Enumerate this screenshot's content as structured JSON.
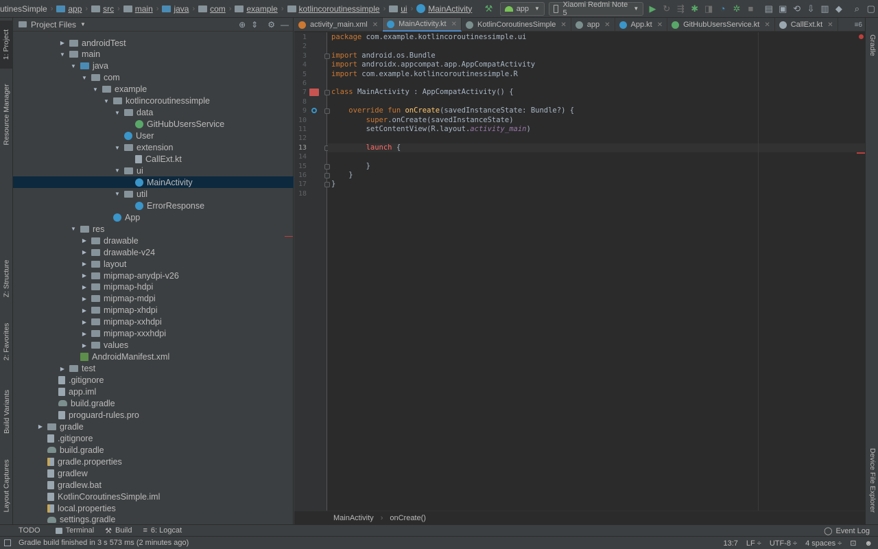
{
  "navbar": {
    "breadcrumbs": [
      "utinesSimple",
      "app",
      "src",
      "main",
      "java",
      "com",
      "example",
      "kotlincoroutinessimple",
      "ui",
      "MainActivity"
    ],
    "run_config": "app",
    "device": "Xiaomi Redmi Note 5"
  },
  "left_tool_tabs": [
    "1: Project",
    "Resource Manager",
    "Z: Structure",
    "2: Favorites",
    "Build Variants",
    "Layout Captures"
  ],
  "right_tool_tabs": [
    "Gradle",
    "Device File Explorer"
  ],
  "project_panel": {
    "title": "Project Files",
    "tree": [
      {
        "label": "androidTest",
        "arrow": "▶",
        "icon": "folder"
      },
      {
        "label": "main",
        "arrow": "▼",
        "icon": "folder"
      },
      {
        "label": "java",
        "arrow": "▼",
        "icon": "folder-blue"
      },
      {
        "label": "com",
        "arrow": "▼",
        "icon": "folder"
      },
      {
        "label": "example",
        "arrow": "▼",
        "icon": "folder"
      },
      {
        "label": "kotlincoroutinessimple",
        "arrow": "▼",
        "icon": "folder"
      },
      {
        "label": "data",
        "arrow": "▼",
        "icon": "folder"
      },
      {
        "label": "GitHubUsersService",
        "arrow": "",
        "icon": "kinterface"
      },
      {
        "label": "User",
        "arrow": "",
        "icon": "kclass"
      },
      {
        "label": "extension",
        "arrow": "▼",
        "icon": "folder"
      },
      {
        "label": "CallExt.kt",
        "arrow": "",
        "icon": "file"
      },
      {
        "label": "ui",
        "arrow": "▼",
        "icon": "folder"
      },
      {
        "label": "MainActivity",
        "arrow": "",
        "icon": "kclass"
      },
      {
        "label": "util",
        "arrow": "▼",
        "icon": "folder"
      },
      {
        "label": "ErrorResponse",
        "arrow": "",
        "icon": "kclass"
      },
      {
        "label": "App",
        "arrow": "",
        "icon": "kclass"
      },
      {
        "label": "res",
        "arrow": "▼",
        "icon": "folder"
      },
      {
        "label": "drawable",
        "arrow": "▶",
        "icon": "folder"
      },
      {
        "label": "drawable-v24",
        "arrow": "▶",
        "icon": "folder"
      },
      {
        "label": "layout",
        "arrow": "▶",
        "icon": "folder"
      },
      {
        "label": "mipmap-anydpi-v26",
        "arrow": "▶",
        "icon": "folder"
      },
      {
        "label": "mipmap-hdpi",
        "arrow": "▶",
        "icon": "folder"
      },
      {
        "label": "mipmap-mdpi",
        "arrow": "▶",
        "icon": "folder"
      },
      {
        "label": "mipmap-xhdpi",
        "arrow": "▶",
        "icon": "folder"
      },
      {
        "label": "mipmap-xxhdpi",
        "arrow": "▶",
        "icon": "folder"
      },
      {
        "label": "mipmap-xxxhdpi",
        "arrow": "▶",
        "icon": "folder"
      },
      {
        "label": "values",
        "arrow": "▶",
        "icon": "folder"
      },
      {
        "label": "AndroidManifest.xml",
        "arrow": "",
        "icon": "xml"
      },
      {
        "label": "test",
        "arrow": "▶",
        "icon": "folder"
      },
      {
        "label": ".gitignore",
        "arrow": "",
        "icon": "file"
      },
      {
        "label": "app.iml",
        "arrow": "",
        "icon": "file"
      },
      {
        "label": "build.gradle",
        "arrow": "",
        "icon": "gradle"
      },
      {
        "label": "proguard-rules.pro",
        "arrow": "",
        "icon": "file"
      },
      {
        "label": "gradle",
        "arrow": "▶",
        "icon": "folder"
      },
      {
        "label": ".gitignore",
        "arrow": "",
        "icon": "file"
      },
      {
        "label": "build.gradle",
        "arrow": "",
        "icon": "gradle"
      },
      {
        "label": "gradle.properties",
        "arrow": "",
        "icon": "props"
      },
      {
        "label": "gradlew",
        "arrow": "",
        "icon": "file"
      },
      {
        "label": "gradlew.bat",
        "arrow": "",
        "icon": "file"
      },
      {
        "label": "KotlinCoroutinesSimple.iml",
        "arrow": "",
        "icon": "file"
      },
      {
        "label": "local.properties",
        "arrow": "",
        "icon": "props"
      },
      {
        "label": "settings.gradle",
        "arrow": "",
        "icon": "gradle"
      }
    ],
    "selected": "MainActivity"
  },
  "editor": {
    "tabs": [
      {
        "label": "activity_main.xml",
        "icon_color": "#cc7832",
        "active": false
      },
      {
        "label": "MainActivity.kt",
        "icon_color": "#3a95c9",
        "active": true
      },
      {
        "label": "KotlinCoroutinesSimple",
        "icon_color": "#7c8f8f",
        "active": false
      },
      {
        "label": "app",
        "icon_color": "#7c8f8f",
        "active": false
      },
      {
        "label": "App.kt",
        "icon_color": "#3a95c9",
        "active": false
      },
      {
        "label": "GitHubUsersService.kt",
        "icon_color": "#59a869",
        "active": false
      },
      {
        "label": "CallExt.kt",
        "icon_color": "#9aa7b0",
        "active": false
      }
    ],
    "tabs_overflow": "≡6",
    "current_line": 13,
    "lines": [
      [
        [
          "kw",
          "package "
        ],
        [
          "pkg",
          "com.example.kotlincoroutinessimple.ui"
        ]
      ],
      [],
      [
        [
          "kw",
          "import "
        ],
        [
          "pkg",
          "android.os.Bundle"
        ]
      ],
      [
        [
          "kw",
          "import "
        ],
        [
          "pkg",
          "androidx.appcompat.app.AppCompatActivity"
        ]
      ],
      [
        [
          "kw",
          "import "
        ],
        [
          "pkg",
          "com.example.kotlincoroutinessimple.R"
        ]
      ],
      [],
      [
        [
          "kw",
          "class "
        ],
        [
          "pkg",
          "MainActivity : AppCompatActivity() {"
        ]
      ],
      [],
      [
        [
          "pkg",
          "    "
        ],
        [
          "kw",
          "override fun "
        ],
        [
          "fn",
          "onCreate"
        ],
        [
          "pkg",
          "(savedInstanceState: Bundle?) {"
        ]
      ],
      [
        [
          "pkg",
          "        "
        ],
        [
          "kw",
          "super"
        ],
        [
          "pkg",
          ".onCreate(savedInstanceState)"
        ]
      ],
      [
        [
          "pkg",
          "        setContentView(R.layout."
        ],
        [
          "it",
          "activity_main"
        ],
        [
          "pkg",
          ")"
        ]
      ],
      [],
      [
        [
          "pkg",
          "        "
        ],
        [
          "red",
          "launch"
        ],
        [
          "pkg",
          " {"
        ]
      ],
      [],
      [
        [
          "pkg",
          "        }"
        ]
      ],
      [
        [
          "pkg",
          "    }"
        ]
      ],
      [
        [
          "pkg",
          "}"
        ]
      ],
      []
    ],
    "bottom_breadcrumb": [
      "MainActivity",
      "onCreate()"
    ]
  },
  "bottom_tools": {
    "todo": "TODO",
    "terminal": "Terminal",
    "build": "Build",
    "logcat": "6: Logcat",
    "event_log": "Event Log"
  },
  "status": {
    "message": "Gradle build finished in 3 s 573 ms (2 minutes ago)",
    "position": "13:7",
    "line_sep": "LF ÷",
    "encoding": "UTF-8 ÷",
    "indent": "4 spaces ÷"
  }
}
